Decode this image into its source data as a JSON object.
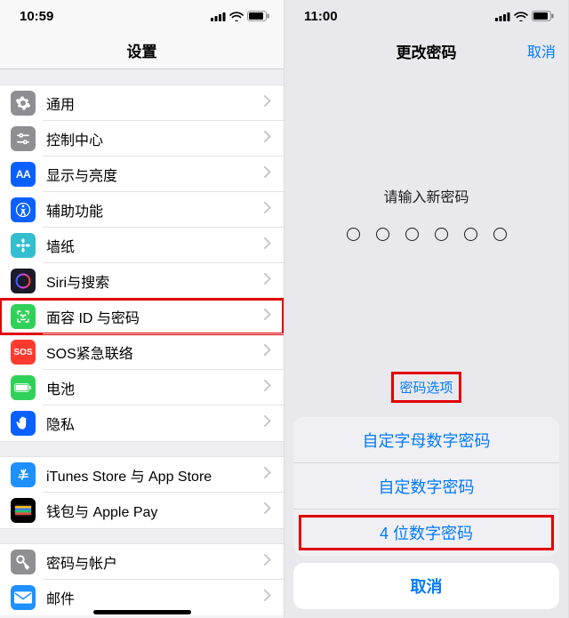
{
  "left": {
    "time": "10:59",
    "title": "设置",
    "groups": [
      [
        {
          "icon": "gear",
          "bg": "#8e8e93",
          "label": "通用"
        },
        {
          "icon": "sliders",
          "bg": "#8e8e93",
          "label": "控制中心"
        },
        {
          "icon": "AA",
          "bg": "#0a60ff",
          "label": "显示与亮度"
        },
        {
          "icon": "access",
          "bg": "#0a60ff",
          "label": "辅助功能"
        },
        {
          "icon": "flower",
          "bg": "#33bed0",
          "label": "墙纸"
        },
        {
          "icon": "siri",
          "bg": "#1b1b2b",
          "label": "Siri与搜索"
        },
        {
          "icon": "faceid",
          "bg": "#30d158",
          "label": "面容 ID 与密码",
          "hl": true
        },
        {
          "icon": "SOS",
          "bg": "#ff3b30",
          "label": "SOS紧急联络"
        },
        {
          "icon": "battery",
          "bg": "#30d158",
          "label": "电池"
        },
        {
          "icon": "hand",
          "bg": "#0a60ff",
          "label": "隐私"
        }
      ],
      [
        {
          "icon": "astore",
          "bg": "#1e90ff",
          "label": "iTunes Store 与 App Store"
        },
        {
          "icon": "wallet",
          "bg": "#000",
          "label": "钱包与 Apple Pay"
        }
      ],
      [
        {
          "icon": "key",
          "bg": "#8e8e93",
          "label": "密码与帐户"
        },
        {
          "icon": "mail",
          "bg": "#1e90ff",
          "label": "邮件"
        }
      ]
    ]
  },
  "right": {
    "time": "11:00",
    "title": "更改密码",
    "cancel": "取消",
    "prompt": "请输入新密码",
    "options_label": "密码选项",
    "sheet": [
      "自定字母数字密码",
      "自定数字密码",
      "4 位数字密码"
    ],
    "sheet_cancel": "取消"
  }
}
